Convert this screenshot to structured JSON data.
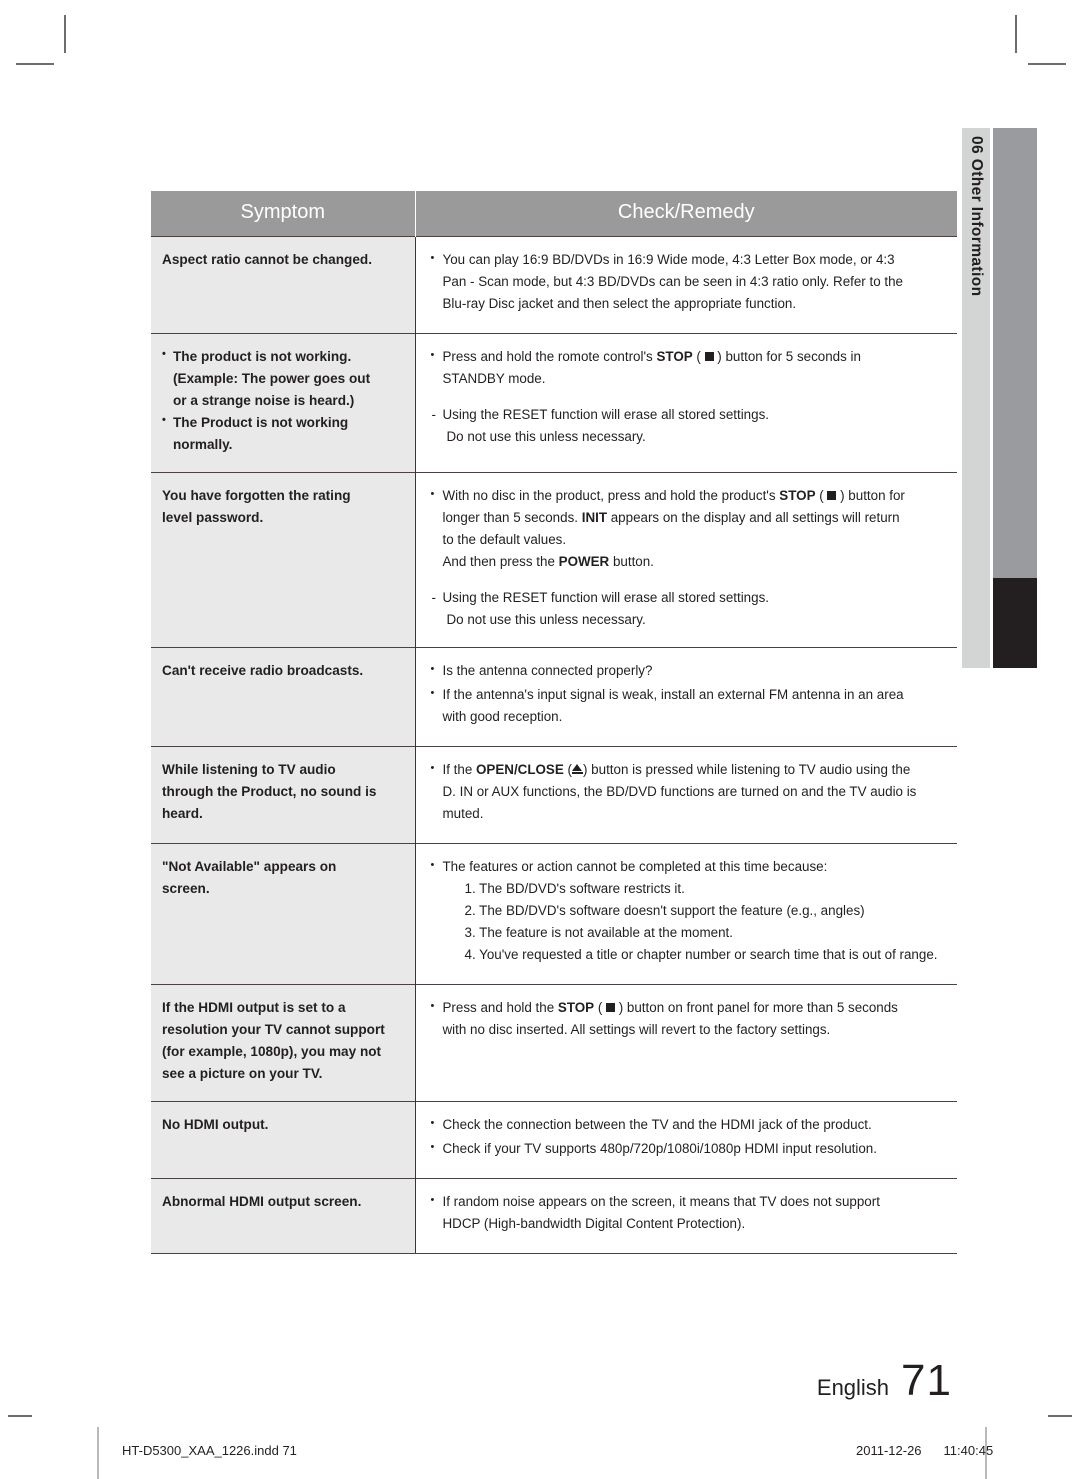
{
  "side_tab": {
    "chapter_number": "06",
    "chapter_title": "Other Information",
    "combined": "06  Other Information"
  },
  "table": {
    "headers": {
      "symptom": "Symptom",
      "remedy": "Check/Remedy"
    },
    "rows": [
      {
        "symptom_lines": [
          "Aspect ratio cannot be changed."
        ],
        "remedy_lines": [
          "You can play 16:9 BD/DVDs in 16:9 Wide mode, 4:3 Letter Box mode, or 4:3",
          "Pan - Scan mode, but 4:3 BD/DVDs can be seen in 4:3 ratio only. Refer to the",
          "Blu-ray Disc jacket and then select the appropriate function."
        ]
      },
      {
        "symptom_lines": [
          "The product is not working.",
          "(Example: The power goes out",
          "or a strange noise is heard.)",
          "The Product is not working",
          "normally."
        ],
        "remedy_lines": [
          "Press and hold the romote control's STOP (  ) button for 5 seconds in",
          "STANDBY mode.",
          "- Using the RESET function will erase all stored settings.",
          "Do not use this unless necessary."
        ]
      },
      {
        "symptom_lines": [
          "You have forgotten the rating",
          "level password."
        ],
        "remedy_lines": [
          "With no disc in the product, press and hold the product's STOP (  ) button for",
          "longer than 5 seconds. INIT appears on the display and all settings will return",
          "to the default values.",
          "And then press the POWER button.",
          "- Using the RESET function will erase all stored settings.",
          "Do not use this unless necessary."
        ]
      },
      {
        "symptom_lines": [
          "Can't receive radio broadcasts."
        ],
        "remedy_lines": [
          "Is the antenna connected properly?",
          "If the antenna's input signal is weak, install an external FM antenna in an area",
          "with good reception."
        ]
      },
      {
        "symptom_lines": [
          "While listening to TV audio",
          "through the Product, no sound is",
          "heard."
        ],
        "remedy_lines": [
          "If the OPEN/CLOSE (  ) button is pressed while listening to TV audio using the",
          "D. IN or AUX functions, the BD/DVD functions are turned on and the TV audio is",
          "muted."
        ]
      },
      {
        "symptom_lines": [
          "\"Not Available\" appears on",
          "screen."
        ],
        "remedy_lines": [
          "The features or action cannot be completed at this time because:",
          "1. The BD/DVD's software restricts it.",
          "2. The BD/DVD's software doesn't support the feature (e.g., angles)",
          "3. The feature is not available at the moment.",
          "4. You've requested a title or chapter number or search time that is out of range."
        ]
      },
      {
        "symptom_lines": [
          "If the HDMI output is set to a",
          "resolution your TV cannot support",
          "(for example, 1080p), you may not",
          "see a picture on your TV."
        ],
        "remedy_lines": [
          "Press and hold the STOP (  ) button on front panel for more than 5 seconds",
          "with no disc inserted. All settings will revert to the factory settings."
        ]
      },
      {
        "symptom_lines": [
          "No HDMI output."
        ],
        "remedy_lines": [
          "Check the connection between the TV and the HDMI jack of the product.",
          "Check if your TV supports 480p/720p/1080i/1080p HDMI input resolution."
        ]
      },
      {
        "symptom_lines": [
          "Abnormal HDMI output screen."
        ],
        "remedy_lines": [
          "If random noise appears on the screen, it means that TV does not support",
          "HDCP (High-bandwidth Digital Content Protection)."
        ]
      }
    ],
    "row1": {
      "sym1": "Aspect ratio cannot be changed.",
      "r1a": "You can play 16:9 BD/DVDs in 16:9 Wide mode, 4:3 Letter Box mode, or 4:3",
      "r1b": "Pan - Scan mode, but 4:3 BD/DVDs can be seen in 4:3 ratio only. Refer to the",
      "r1c": "Blu-ray Disc jacket and then select the appropriate function."
    },
    "row2": {
      "s2a": "The product is not working.",
      "s2b": "(Example: The power goes out",
      "s2c": "or a strange noise is heard.)",
      "s2d": "The Product is not working",
      "s2e": "normally.",
      "r2_pre": "Press and hold the romote control's ",
      "r2_stop": "STOP",
      "r2_mid": " ( ",
      "r2_post": " ) button for 5 seconds in",
      "r2_line2": "STANDBY mode.",
      "r2_dash1": "Using the RESET function will erase all stored settings.",
      "r2_dash2": "Do not use this unless necessary."
    },
    "row3": {
      "s3a": "You have forgotten the rating",
      "s3b": "level password.",
      "r3_pre": "With no disc in the product, press and hold the product's ",
      "r3_stop": "STOP",
      "r3_mid": " ( ",
      "r3_post": " ) button for",
      "r3_l2a": "longer than 5 seconds. ",
      "r3_init": "INIT",
      "r3_l2b": " appears on the display and all settings will return",
      "r3_l3": "to the default values.",
      "r3_l4a": "And then press the ",
      "r3_power": "POWER",
      "r3_l4b": " button.",
      "r3_dash1": "Using the RESET function will erase all stored settings.",
      "r3_dash2": "Do not use this unless necessary."
    },
    "row4": {
      "s4": "Can't receive radio broadcasts.",
      "r4a": "Is the antenna connected properly?",
      "r4b": "If the antenna's input signal is weak, install an external FM antenna in an area",
      "r4c": "with good reception."
    },
    "row5": {
      "s5a": "While listening to TV audio",
      "s5b": "through the Product, no sound is",
      "s5c": "heard.",
      "r5_pre": "If the ",
      "r5_oc": "OPEN/CLOSE",
      "r5_mid": " (",
      "r5_post": ") button is pressed while listening to TV audio using the",
      "r5_l2": "D. IN or AUX functions, the BD/DVD functions are turned on and the TV audio is",
      "r5_l3": "muted."
    },
    "row6": {
      "s6a": "\"Not Available\" appears on",
      "s6b": "screen.",
      "r6a": "The features or action cannot be completed at this time because:",
      "r6b": "1. The BD/DVD's software restricts it.",
      "r6c": "2. The BD/DVD's software doesn't support the feature (e.g., angles)",
      "r6d": "3. The feature is not available at the moment.",
      "r6e": "4. You've requested a title or chapter number or search time that is out of range."
    },
    "row7": {
      "s7a": "If the HDMI output is set to a",
      "s7b": "resolution your TV cannot support",
      "s7c": "(for example, 1080p), you may not",
      "s7d": "see a picture on your TV.",
      "r7_pre": "Press and hold the ",
      "r7_stop": "STOP",
      "r7_mid": " ( ",
      "r7_post": " ) button on front panel for more than 5 seconds",
      "r7_l2": "with no disc inserted. All settings will revert to the factory settings."
    },
    "row8": {
      "s8": "No HDMI output.",
      "r8a": "Check the connection between the TV and the HDMI jack of the product.",
      "r8b": "Check if your TV supports 480p/720p/1080i/1080p HDMI input resolution."
    },
    "row9": {
      "s9": "Abnormal HDMI output screen.",
      "r9a": "If random noise appears on the screen, it means that TV does not support",
      "r9b": "HDCP (High-bandwidth Digital Content Protection)."
    }
  },
  "footer": {
    "language": "English",
    "page_number": "71",
    "file_name": "HT-D5300_XAA_1226.indd   71",
    "date": "2011-12-26",
    "time": "11:40:45"
  },
  "colors": {
    "header_gray": "#9a9a9a",
    "symptom_bg": "#e9e9e9",
    "side_tab_bg": "#d3d4d4",
    "side_bar_gray": "#999b9e",
    "side_bar_black": "#231f20",
    "text": "#231f20"
  }
}
